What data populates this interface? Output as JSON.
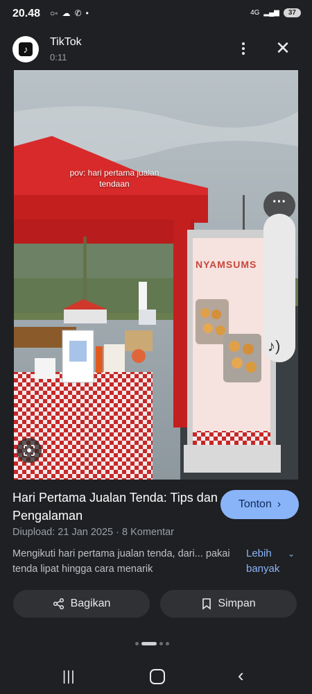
{
  "status_bar": {
    "time": "20.48",
    "left_icons": [
      "notification-icon",
      "cloud-icon",
      "whatsapp-icon",
      "dot-icon"
    ],
    "network": "4G",
    "battery": "37"
  },
  "header": {
    "app_name": "TikTok",
    "duration": "0:11",
    "icons": [
      "tiktok-logo",
      "more-vert-icon",
      "close-icon"
    ]
  },
  "video": {
    "caption_line1": "pov: hari pertama jualan",
    "caption_line2": "tendaan",
    "banner_text": "NYAMSUMS"
  },
  "result": {
    "title": "Hari Pertama Jualan Tenda: Tips dan Pengalaman",
    "watch_label": "Tonton",
    "uploaded": "Diupload: 21 Jan 2025",
    "separator": "·",
    "comments": "8 Komentar",
    "description": "Mengikuti hari pertama jualan tenda, dari... pakai tenda lipat hingga cara menarik",
    "more_label": "Lebih banyak"
  },
  "actions": {
    "share_label": "Bagikan",
    "save_label": "Simpan"
  },
  "colors": {
    "background": "#1f2023",
    "accent": "#8ab4f8",
    "button_bg": "#303134",
    "tent_red": "#d82a2a"
  },
  "pager": {
    "count": 4,
    "active_index": 1
  }
}
